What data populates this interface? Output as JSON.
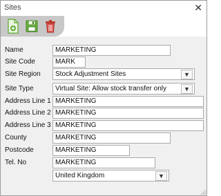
{
  "window": {
    "title": "Sites",
    "close_glyph": "✕"
  },
  "toolbar": {
    "buttons": [
      {
        "name": "new-document-icon",
        "color": "#5aa82a"
      },
      {
        "name": "save-icon",
        "color": "#4c9a2a"
      },
      {
        "name": "delete-icon",
        "color": "#c0392b"
      }
    ]
  },
  "form": {
    "name": {
      "label": "Name",
      "value": "MARKETING"
    },
    "site_code": {
      "label": "Site Code",
      "value": "MARK"
    },
    "site_region": {
      "label": "Site Region",
      "value": "Stock Adjustment Sites"
    },
    "site_type": {
      "label": "Site Type",
      "value": "Virtual Site: Allow stock transfer only"
    },
    "address1": {
      "label": "Address Line 1",
      "value": "MARKETING"
    },
    "address2": {
      "label": "Address Line 2",
      "value": "MARKETING"
    },
    "address3": {
      "label": "Address Line 3",
      "value": "MARKETING"
    },
    "county": {
      "label": "County",
      "value": "MARKETING"
    },
    "postcode": {
      "label": "Postcode",
      "value": "MARKETING"
    },
    "tel_no": {
      "label": "Tel. No",
      "value": "MARKETING"
    },
    "country": {
      "value": "United Kingdom"
    }
  },
  "dropdown_glyph": "▼"
}
